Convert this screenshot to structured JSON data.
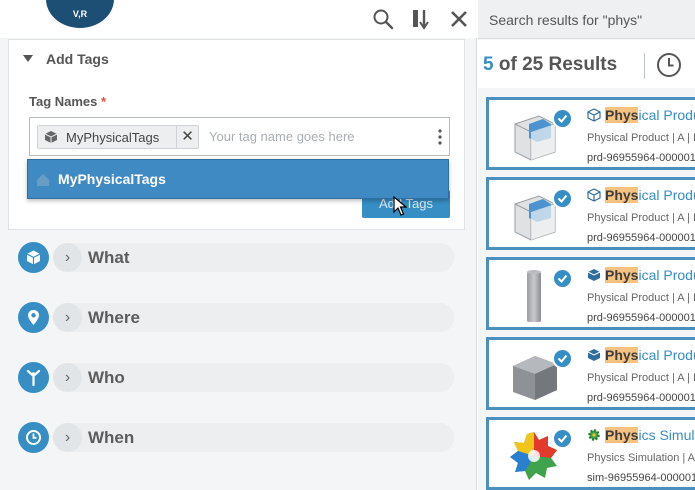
{
  "left_panel": {
    "logo_text": "V,R",
    "toolbar": {
      "search_icon": "search-icon",
      "sort_icon": "sort-icon",
      "close_icon": "close-icon"
    },
    "add_tags": {
      "title": "Add Tags",
      "field_label": "Tag Names",
      "required_mark": "*",
      "chip_label": "MyPhysicalTags",
      "chip_remove": "✕",
      "placeholder": "Your tag name goes here",
      "button_label": "Add Tags",
      "dropdown_option": "MyPhysicalTags"
    },
    "facets": [
      {
        "label": "What",
        "icon": "cube-icon"
      },
      {
        "label": "Where",
        "icon": "location-pin-icon"
      },
      {
        "label": "Who",
        "icon": "person-icon"
      },
      {
        "label": "When",
        "icon": "clock-icon"
      }
    ]
  },
  "right_panel": {
    "search_header": "Search results for \"phys\"",
    "results": {
      "current": "5",
      "of": "of",
      "total": "25",
      "word": "Results"
    },
    "items": [
      {
        "highlight": "Phys",
        "rest": "ical Produ",
        "sub": "Physical Product | A | I",
        "id": "prd-96955964-000001",
        "thumb": "cube"
      },
      {
        "highlight": "Phys",
        "rest": "ical Produ",
        "sub": "Physical Product | A | I",
        "id": "prd-96955964-000001",
        "thumb": "cube"
      },
      {
        "highlight": "Phys",
        "rest": "ical Produ",
        "sub": "Physical Product | A | I",
        "id": "prd-96955964-000001",
        "thumb": "cylinder"
      },
      {
        "highlight": "Phys",
        "rest": "ical Produ",
        "sub": "Physical Product | A | I",
        "id": "prd-96955964-000001",
        "thumb": "box"
      },
      {
        "highlight": "Phys",
        "rest": "ics Simula",
        "sub": "Physics Simulation | A",
        "id": "sim-96955964-000001",
        "thumb": "gear"
      }
    ]
  },
  "colors": {
    "accent": "#368ec4",
    "highlight": "#f6c27f",
    "dropdown": "#3f8ac3"
  }
}
